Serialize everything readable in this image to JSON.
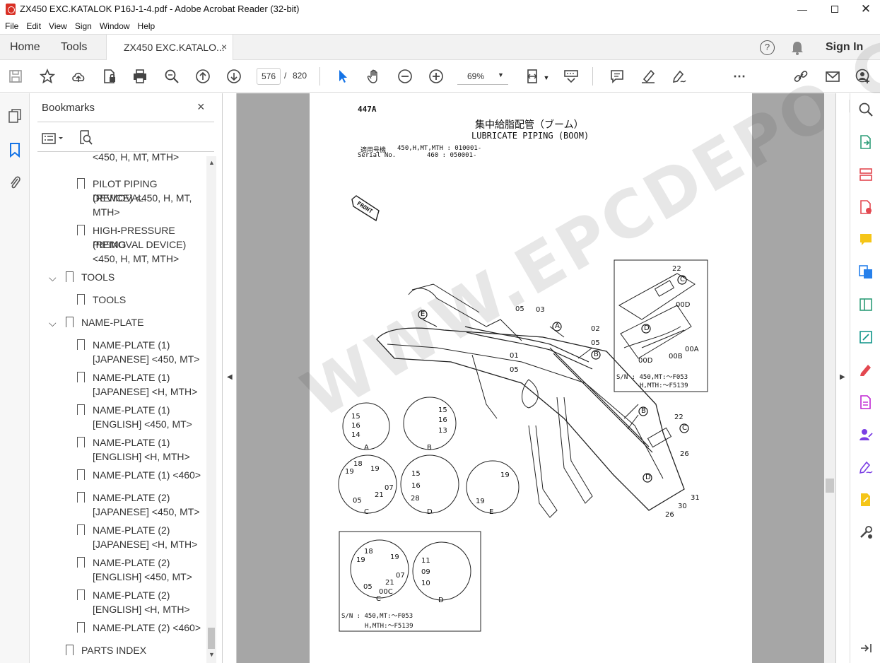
{
  "window": {
    "title": "ZX450 EXC.KATALOK P16J-1-4.pdf - Adobe Acrobat Reader (32-bit)"
  },
  "menu": [
    "File",
    "Edit",
    "View",
    "Sign",
    "Window",
    "Help"
  ],
  "topnav": {
    "home": "Home",
    "tools": "Tools",
    "sign_in": "Sign In"
  },
  "doc_tab": {
    "label": "ZX450 EXC.KATALO...",
    "close": "×"
  },
  "toolbar": {
    "page_current": "576",
    "page_sep": "/",
    "page_total": "820",
    "zoom": "69%"
  },
  "bookmarks": {
    "title": "Bookmarks",
    "close": "×",
    "items": [
      {
        "lines": [
          "<450, H, MT, MTH>"
        ]
      },
      {
        "lines": [
          "PILOT PIPING (REMOVAL",
          "DEVICE) <450, H, MT,",
          "MTH>"
        ]
      },
      {
        "lines": [
          "HIGH-PRESSURE PIPING",
          "(REMOVAL DEVICE)",
          "<450, H, MT, MTH>"
        ]
      },
      {
        "lines": [
          "TOOLS"
        ]
      },
      {
        "lines": [
          "TOOLS"
        ]
      },
      {
        "lines": [
          "NAME-PLATE"
        ]
      },
      {
        "lines": [
          "NAME-PLATE (1)",
          "[JAPANESE] <450, MT>"
        ]
      },
      {
        "lines": [
          "NAME-PLATE (1)",
          "[JAPANESE] <H, MTH>"
        ]
      },
      {
        "lines": [
          "NAME-PLATE (1)",
          "[ENGLISH] <450, MT>"
        ]
      },
      {
        "lines": [
          "NAME-PLATE (1)",
          "[ENGLISH] <H, MTH>"
        ]
      },
      {
        "lines": [
          "NAME-PLATE (1) <460>"
        ]
      },
      {
        "lines": [
          "NAME-PLATE (2)",
          "[JAPANESE] <450, MT>"
        ]
      },
      {
        "lines": [
          "NAME-PLATE (2)",
          "[JAPANESE] <H, MTH>"
        ]
      },
      {
        "lines": [
          "NAME-PLATE (2)",
          "[ENGLISH] <450, MT>"
        ]
      },
      {
        "lines": [
          "NAME-PLATE (2)",
          "[ENGLISH] <H, MTH>"
        ]
      },
      {
        "lines": [
          "NAME-PLATE (2) <460>"
        ]
      },
      {
        "lines": [
          "PARTS INDEX"
        ]
      }
    ]
  },
  "page": {
    "page_code": "447A",
    "title_jp": "集中給脂配管（ブーム）",
    "title_en": "LUBRICATE PIPING (BOOM)",
    "serial_label_jp": "適用号機",
    "serial_label_en": "Serial No.",
    "serial_1": "450,H,MT,MTH : 010001-",
    "serial_2": "460 : 050001-",
    "front_label": "FRONT",
    "inset_note_1": "S/N : 450,MT:～F053",
    "inset_note_2": "H,MTH:～F5139",
    "watermark": "WWW.EPCDEPO.COM",
    "callouts": [
      "A",
      "B",
      "C",
      "D",
      "E"
    ],
    "part_numbers": [
      "00A",
      "00B",
      "00C",
      "00D",
      "01",
      "02",
      "03",
      "05",
      "07",
      "09",
      "10",
      "11",
      "13",
      "14",
      "15",
      "16",
      "18",
      "19",
      "21",
      "22",
      "26",
      "28",
      "30",
      "31"
    ]
  },
  "colors": {
    "accent": "#1473e6",
    "rail_purple": "#7b3fe4",
    "rail_red": "#e34850"
  }
}
